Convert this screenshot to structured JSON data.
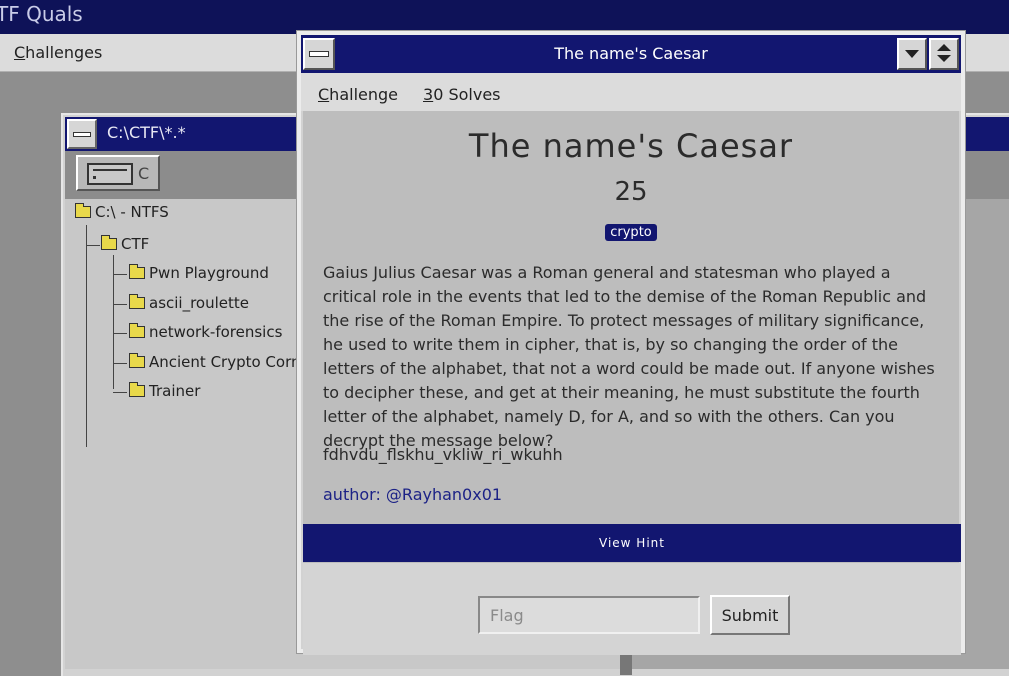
{
  "app": {
    "title": "TF Quals",
    "menu": {
      "challenges": "Challenges"
    }
  },
  "file_manager": {
    "title": "C:\\CTF\\*.*",
    "drive_letter": "C",
    "tree": {
      "root": "C:\\ - NTFS",
      "ctf": "CTF",
      "folders": [
        "Pwn Playground",
        "ascii_roulette",
        "network-forensics",
        "Ancient Crypto Corne",
        "Trainer"
      ]
    }
  },
  "modal": {
    "title": "The name's Caesar",
    "menu": {
      "challenge": "Challenge",
      "solves": "30 Solves"
    },
    "challenge": {
      "name": "The name's Caesar",
      "value": "25",
      "category": "crypto",
      "description": "Gaius Julius Caesar was a Roman general and statesman who played a critical role in the events that led to the demise of the Roman Republic and the rise of the Roman Empire. To protect messages of military significance, he used to write them in cipher, that is, by so changing the order of the letters of the alphabet, that not a word could be made out. If anyone wishes to decipher these, and get at their meaning, he must substitute the fourth letter of the alphabet, namely D, for A, and so with the others. Can you decrypt the message below?",
      "ciphertext": "fdhvdu_flskhu_vkliw_ri_wkuhh",
      "author": "author: @Rayhan0x01"
    },
    "hint_button": "View Hint",
    "flag_placeholder": "Flag",
    "submit_label": "Submit"
  },
  "colors": {
    "titlebar": "#121670",
    "accent": "#1c2286",
    "content_bg": "#bdbdbd"
  }
}
